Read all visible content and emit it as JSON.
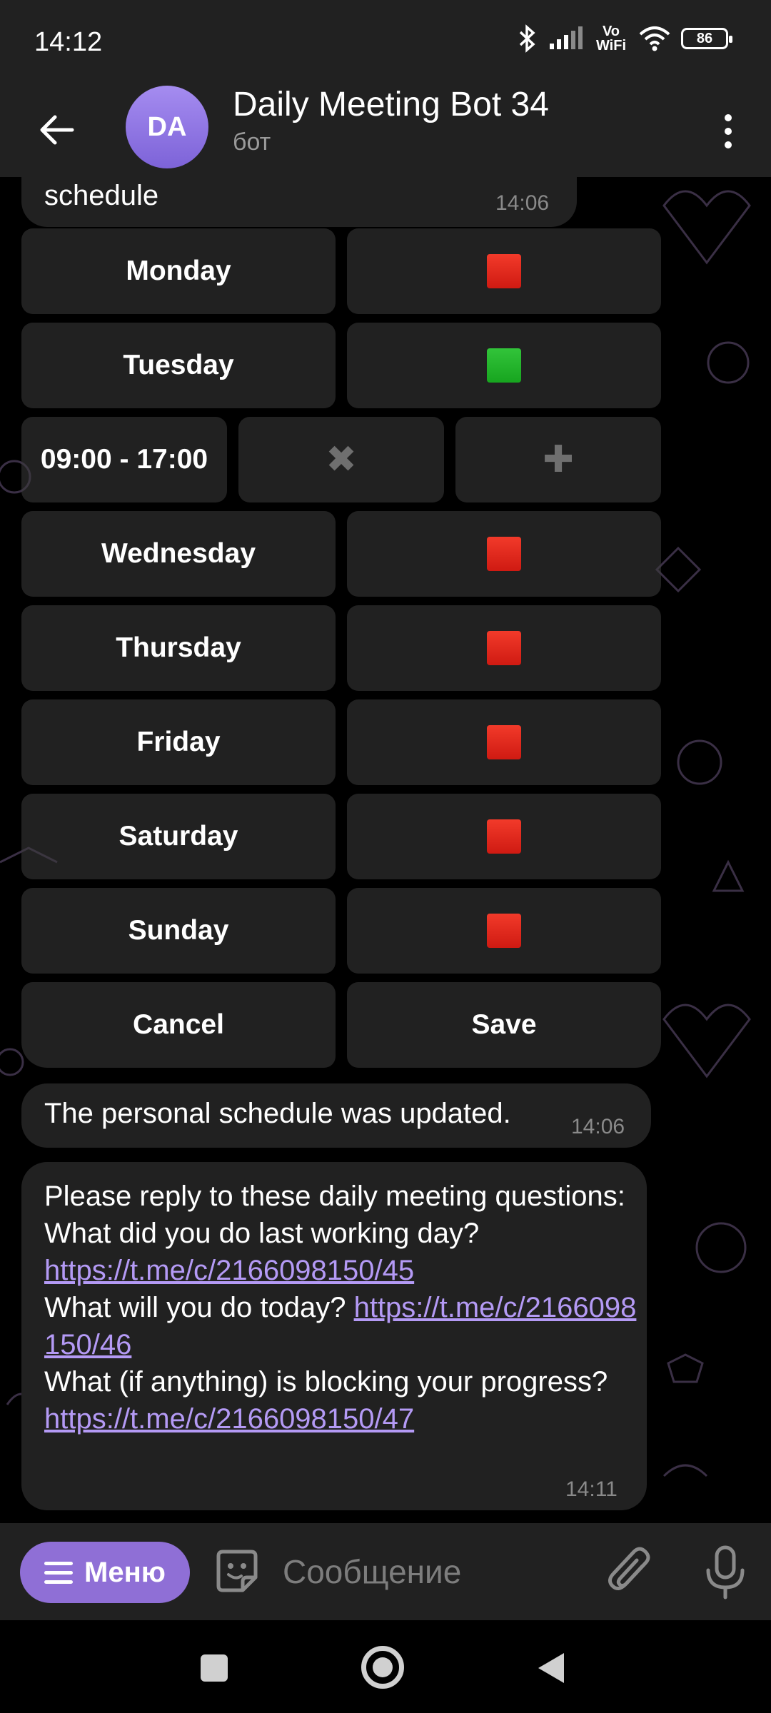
{
  "status_bar": {
    "time": "14:12",
    "vowifi": "Vo WiFi",
    "battery": "86"
  },
  "header": {
    "avatar_initials": "DA",
    "title": "Daily Meeting Bot 34",
    "subtitle": "бот"
  },
  "messages": {
    "schedule": {
      "text": "schedule",
      "time": "14:06"
    },
    "updated": {
      "text": "The personal schedule was updated.",
      "time": "14:06"
    },
    "questions": {
      "intro": "Please reply to these daily meeting questions:",
      "q1_text": "What did you do last working day?",
      "q1_link": "https://t.me/c/2166098150/45",
      "q2_text": "What will you do today?",
      "q2_link": "https://t.me/c/2166098150/46",
      "q3_text": "What (if anything) is blocking your progress?",
      "q3_link": "https://t.me/c/2166098150/47",
      "time": "14:11"
    }
  },
  "keyboard": {
    "days": [
      {
        "label": "Monday",
        "enabled": false
      },
      {
        "label": "Tuesday",
        "enabled": true
      },
      {
        "label": "Wednesday",
        "enabled": false
      },
      {
        "label": "Thursday",
        "enabled": false
      },
      {
        "label": "Friday",
        "enabled": false
      },
      {
        "label": "Saturday",
        "enabled": false
      },
      {
        "label": "Sunday",
        "enabled": false
      }
    ],
    "time_range": "09:00 - 17:00",
    "remove_symbol": "✖",
    "add_symbol": "✚",
    "cancel_label": "Cancel",
    "save_label": "Save"
  },
  "input_bar": {
    "menu_label": "Меню",
    "placeholder": "Сообщение"
  },
  "colors": {
    "accent": "#8f6fd6",
    "link": "#b49af5",
    "toggle_on": "#17a51f",
    "toggle_off": "#cf1a12"
  }
}
